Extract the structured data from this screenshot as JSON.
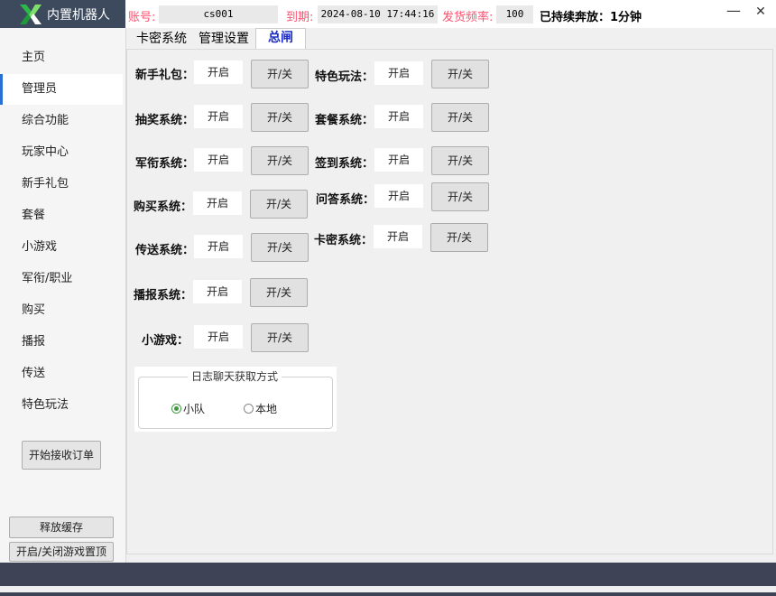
{
  "app": {
    "title": "内置机器人"
  },
  "header": {
    "account_label": "账号:",
    "account_value": "cs001",
    "expire_label": "到期:",
    "expire_value": "2024-08-10 17:44:16",
    "rate_label": "发货频率:",
    "rate_value": "100",
    "sustain_text": "已持续奔放：1分钟",
    "minimize": "—",
    "close": "✕"
  },
  "sidebar": {
    "items": [
      {
        "label": "主页"
      },
      {
        "label": "管理员"
      },
      {
        "label": "综合功能"
      },
      {
        "label": "玩家中心"
      },
      {
        "label": "新手礼包"
      },
      {
        "label": "套餐"
      },
      {
        "label": "小游戏"
      },
      {
        "label": "军衔/职业"
      },
      {
        "label": "购买"
      },
      {
        "label": "播报"
      },
      {
        "label": "传送"
      },
      {
        "label": "特色玩法"
      }
    ],
    "start_orders": "开始接收订单",
    "release_cache": "释放缓存",
    "toggle_topmost": "开启/关闭游戏置顶"
  },
  "tabs": [
    {
      "label": "卡密系统"
    },
    {
      "label": "管理设置"
    },
    {
      "label": "总闸"
    }
  ],
  "left_rows": [
    {
      "label": "新手礼包：",
      "status": "开启",
      "button": "开/关"
    },
    {
      "label": "抽奖系统：",
      "status": "开启",
      "button": "开/关"
    },
    {
      "label": "军衔系统：",
      "status": "开启",
      "button": "开/关"
    },
    {
      "label": "购买系统：",
      "status": "开启",
      "button": "开/关"
    },
    {
      "label": "传送系统：",
      "status": "开启",
      "button": "开/关"
    },
    {
      "label": "播报系统：",
      "status": "开启",
      "button": "开/关"
    },
    {
      "label": "小游戏：",
      "status": "开启",
      "button": "开/关"
    }
  ],
  "right_rows": [
    {
      "label": "特色玩法：",
      "status": "开启",
      "button": "开/关"
    },
    {
      "label": "套餐系统：",
      "status": "开启",
      "button": "开/关"
    },
    {
      "label": "签到系统：",
      "status": "开启",
      "button": "开/关"
    },
    {
      "label": "问答系统：",
      "status": "开启",
      "button": "开/关"
    },
    {
      "label": "卡密系统：",
      "status": "开启",
      "button": "开/关"
    }
  ],
  "log_group": {
    "title": "日志聊天获取方式",
    "options": [
      {
        "label": "小队",
        "selected": true
      },
      {
        "label": "本地",
        "selected": false
      }
    ]
  },
  "colors": {
    "accent": "#2a6fd6",
    "label_red": "#ff4f6e",
    "tab_active": "#1a2bc8",
    "bottom_bar": "#3e4456"
  }
}
